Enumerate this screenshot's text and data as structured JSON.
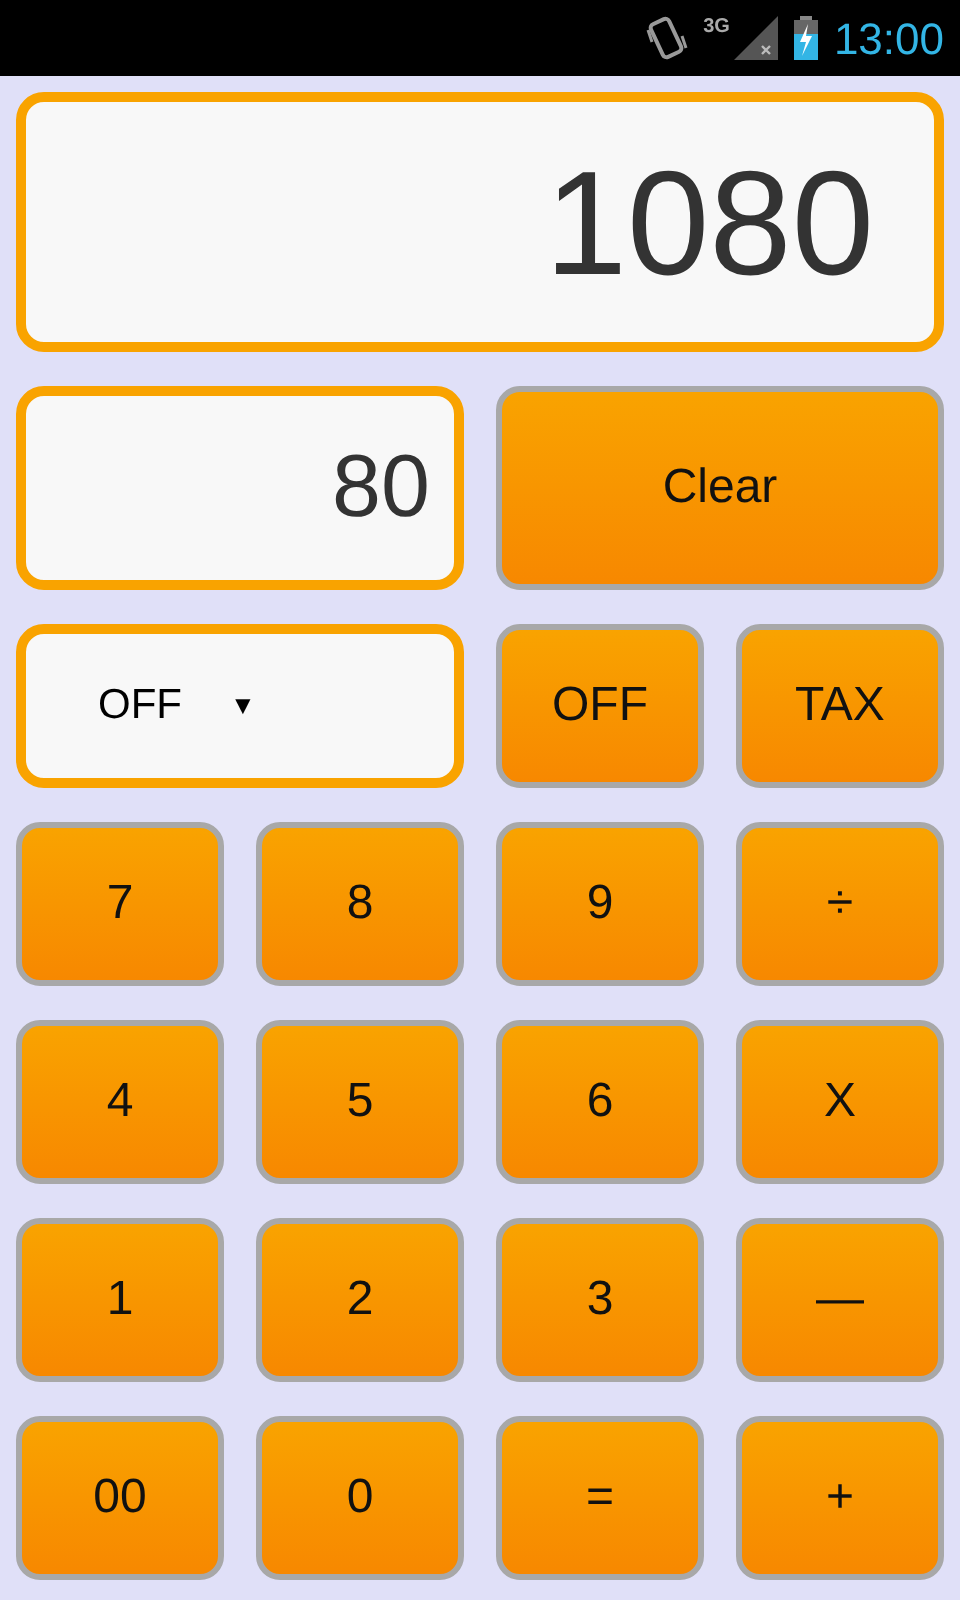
{
  "status_bar": {
    "network": "3G",
    "time": "13:00"
  },
  "display": {
    "value": "1080"
  },
  "input": {
    "value": "80"
  },
  "clear_button": "Clear",
  "tax_spinner": {
    "value": "OFF",
    "arrow": "▼"
  },
  "mode_buttons": [
    "OFF",
    "TAX"
  ],
  "keys": [
    "7",
    "8",
    "9",
    "÷",
    "4",
    "5",
    "6",
    "X",
    "1",
    "2",
    "3",
    "—",
    "00",
    "0",
    "=",
    "+"
  ]
}
